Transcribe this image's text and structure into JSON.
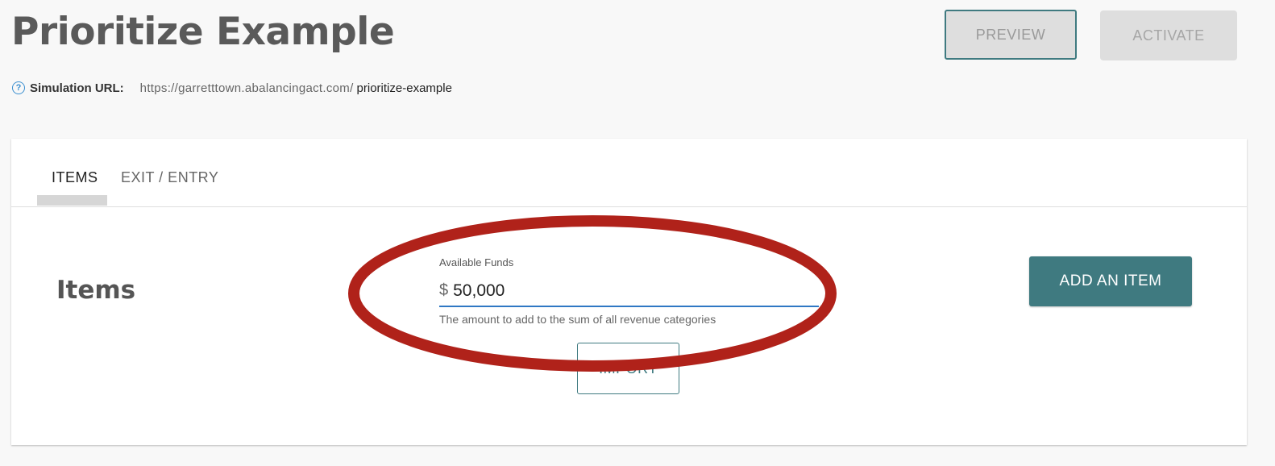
{
  "header": {
    "title": "Prioritize Example",
    "preview_label": "PREVIEW",
    "activate_label": "ACTIVATE"
  },
  "simulation_url": {
    "icon": "help-circle-icon",
    "label": "Simulation URL:",
    "base": "https://garretttown.abalancingact.com/",
    "slug": "prioritize-example"
  },
  "tabs": [
    {
      "label": "ITEMS",
      "active": true
    },
    {
      "label": "EXIT / ENTRY",
      "active": false
    }
  ],
  "items_section": {
    "title": "Items",
    "available_funds": {
      "label": "Available Funds",
      "prefix": "$",
      "value": "50,000",
      "helper": "The amount to add to the sum of all revenue categories"
    },
    "import_label": "IMPORT",
    "add_item_label": "ADD AN ITEM"
  },
  "colors": {
    "accent": "#3f7a80",
    "input_underline": "#2f78c4",
    "annotation": "#b0221a"
  }
}
